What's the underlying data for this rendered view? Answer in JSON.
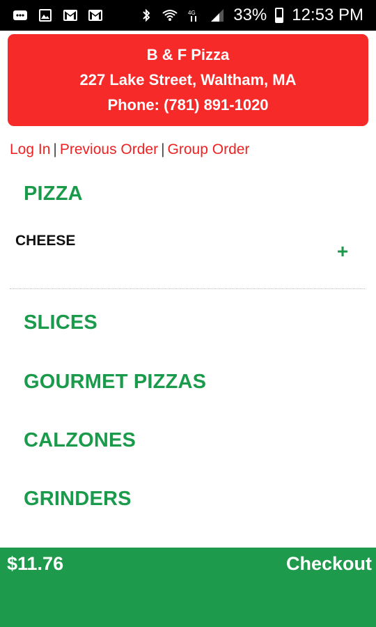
{
  "status_bar": {
    "battery_percent": "33%",
    "time": "12:53 PM",
    "icons": [
      "messages-icon",
      "gallery-icon",
      "gmail-icon",
      "gmail-icon",
      "bluetooth-icon",
      "wifi-icon",
      "4g-icon",
      "signal-icon",
      "battery-icon"
    ]
  },
  "restaurant": {
    "name": "B & F Pizza",
    "address": "227 Lake Street, Waltham, MA",
    "phone": "Phone: (781) 891-1020",
    "header_color": "#f72a2a"
  },
  "links": {
    "login": "Log In",
    "sep1": "|",
    "previous_order": "Previous Order",
    "sep2": "|",
    "group_order": "Group Order"
  },
  "menu": {
    "open_category": "PIZZA",
    "item": {
      "name": "CHEESE",
      "add_symbol": "+"
    },
    "categories": [
      "SLICES",
      "GOURMET PIZZAS",
      "CALZONES",
      "GRINDERS"
    ],
    "accent_color": "#1a9a4b"
  },
  "footer": {
    "total": "$11.76",
    "checkout": "Checkout",
    "color": "#1e9a4c"
  }
}
